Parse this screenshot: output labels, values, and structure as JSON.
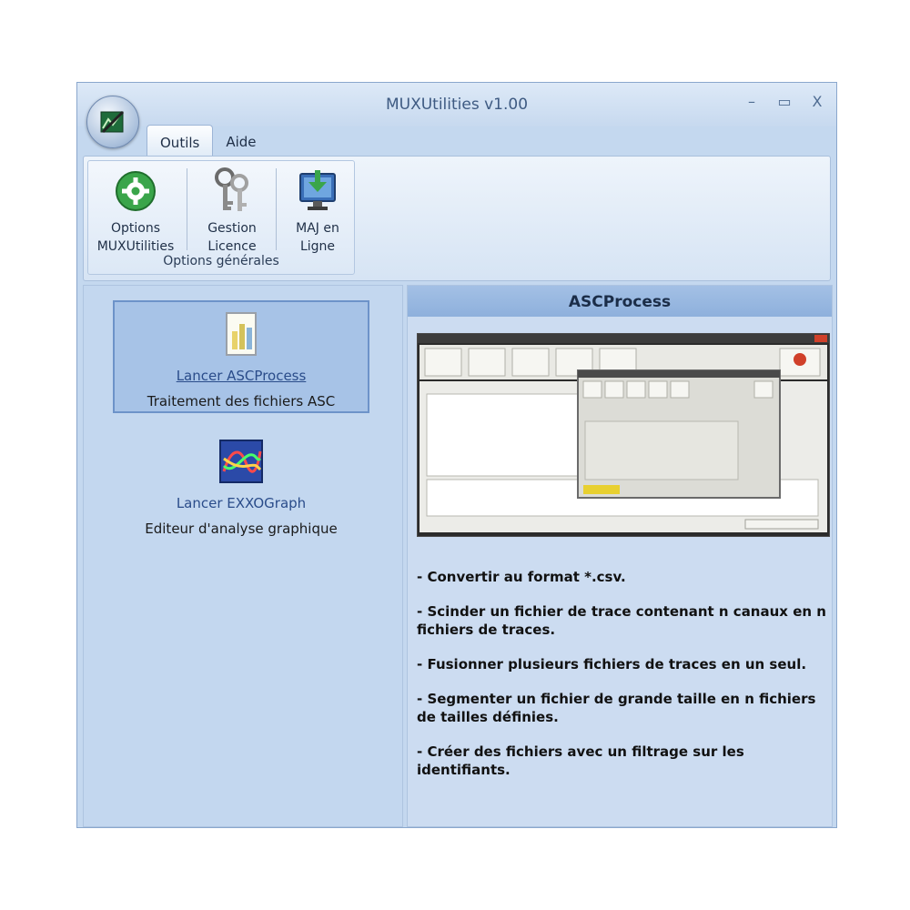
{
  "window": {
    "title": "MUXUtilities v1.00",
    "controls": {
      "minimize": "–",
      "maximize": "▭",
      "close": "X"
    }
  },
  "tabs": [
    {
      "label": "Outils",
      "active": true
    },
    {
      "label": "Aide",
      "active": false
    }
  ],
  "ribbon": {
    "group_label": "Options générales",
    "buttons": [
      {
        "line1": "Options",
        "line2": "MUXUtilities",
        "icon": "gear-icon"
      },
      {
        "line1": "Gestion",
        "line2": "Licence",
        "icon": "keys-icon"
      },
      {
        "line1": "MAJ en",
        "line2": "Ligne",
        "icon": "monitor-download-icon"
      }
    ]
  },
  "left": {
    "items": [
      {
        "link": "Lancer ASCProcess",
        "desc": "Traitement des fichiers ASC",
        "icon": "document-chart-icon",
        "selected": true
      },
      {
        "link": "Lancer EXXOGraph",
        "desc": "Editeur d'analyse graphique",
        "icon": "graph-icon",
        "selected": false
      }
    ]
  },
  "right": {
    "title": "ASCProcess",
    "features": [
      "- Convertir au format *.csv.",
      "- Scinder un fichier de trace contenant n canaux en n fichiers de traces.",
      "- Fusionner plusieurs fichiers de traces en un seul.",
      "- Segmenter un fichier de grande taille en n fichiers de tailles définies.",
      "- Créer des fichiers avec un filtrage sur les identifiants."
    ]
  },
  "colors": {
    "window_bg": "#c4d8ef",
    "header_bg": "#8eb0dc",
    "link": "#2a4c8a",
    "selected_border": "#6d93c9"
  }
}
